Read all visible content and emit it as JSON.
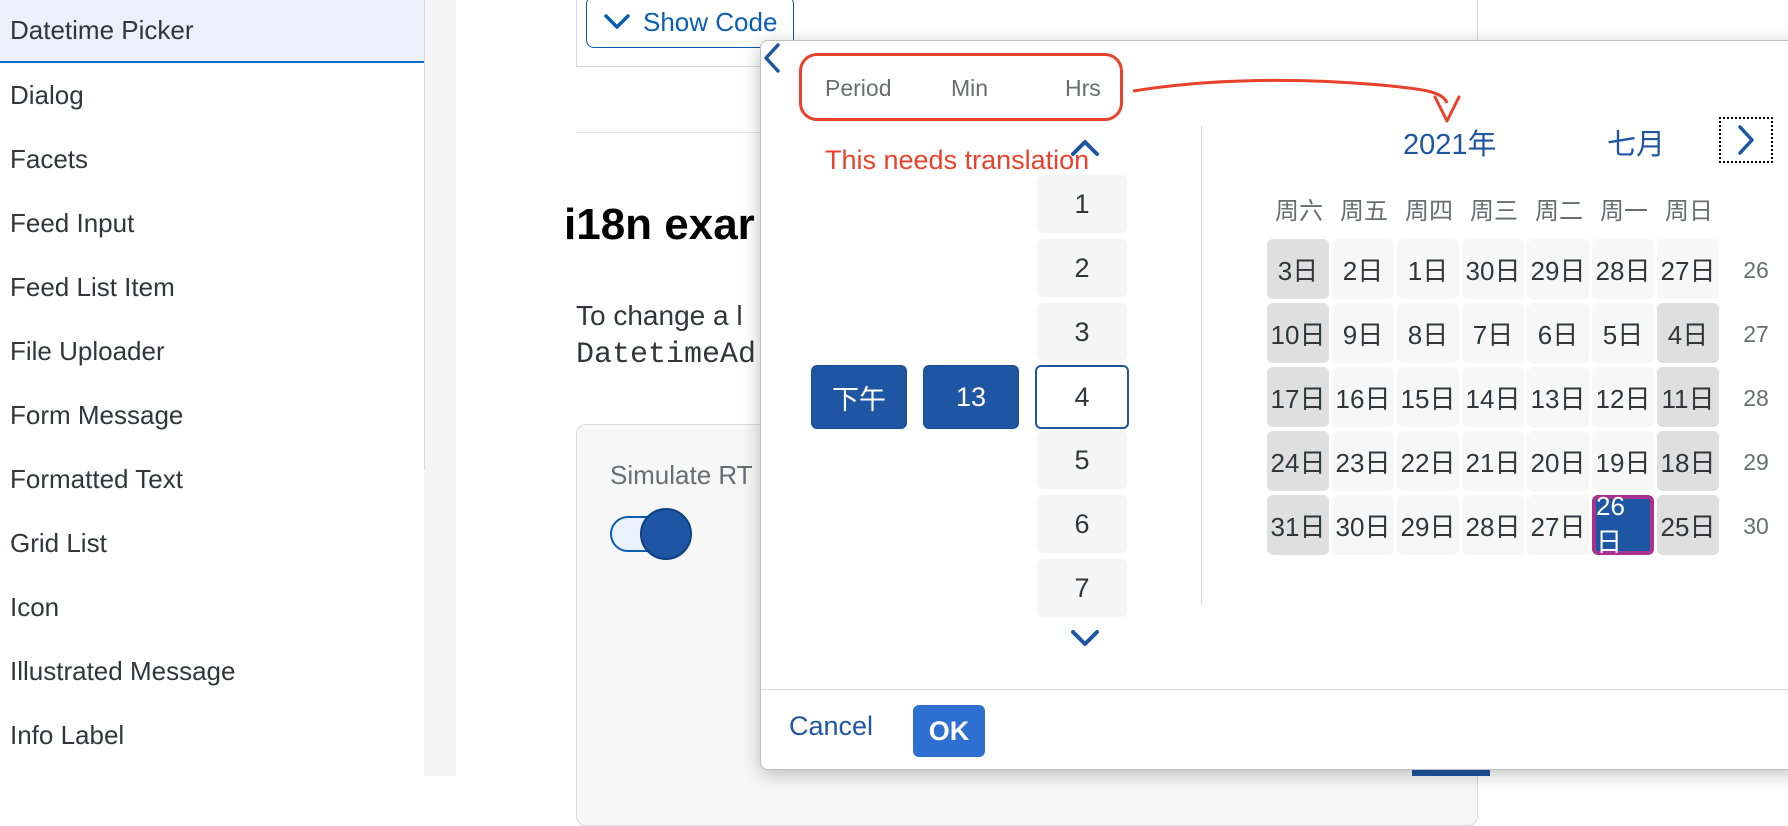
{
  "sidebar": {
    "items": [
      {
        "label": "Datetime Picker",
        "active": true
      },
      {
        "label": "Dialog"
      },
      {
        "label": "Facets"
      },
      {
        "label": "Feed Input"
      },
      {
        "label": "Feed List Item"
      },
      {
        "label": "File Uploader"
      },
      {
        "label": "Form Message"
      },
      {
        "label": "Formatted Text"
      },
      {
        "label": "Grid List"
      },
      {
        "label": "Icon"
      },
      {
        "label": "Illustrated Message"
      },
      {
        "label": "Info Label"
      }
    ]
  },
  "main": {
    "show_code_label": "Show Code",
    "section_title_visible": "i18n exar",
    "para_text_visible": "To change a l",
    "para_code_visible": "DatetimeAd",
    "rtl_label_visible": "Simulate RT",
    "rtl_toggle_on": true
  },
  "picker": {
    "time_headers": [
      "Period",
      "Min",
      "Hrs"
    ],
    "annotation": {
      "text": "This needs translation",
      "color": "#e8412c"
    },
    "period_value": "下午",
    "minute_value": "13",
    "hours": [
      "1",
      "2",
      "3",
      "4",
      "5",
      "6",
      "7"
    ],
    "focused_hour": "4",
    "calendar": {
      "year_label": "2021年",
      "month_label": "七月",
      "weekdays": [
        "周六",
        "周五",
        "周四",
        "周三",
        "周二",
        "周一",
        "周日"
      ],
      "weeks": [
        {
          "number": "26",
          "days": [
            "3日",
            "2日",
            "1日",
            "30日",
            "29日",
            "28日",
            "27日"
          ]
        },
        {
          "number": "27",
          "days": [
            "10日",
            "9日",
            "8日",
            "7日",
            "6日",
            "5日",
            "4日"
          ]
        },
        {
          "number": "28",
          "days": [
            "17日",
            "16日",
            "15日",
            "14日",
            "13日",
            "12日",
            "11日"
          ]
        },
        {
          "number": "29",
          "days": [
            "24日",
            "23日",
            "22日",
            "21日",
            "20日",
            "19日",
            "18日"
          ]
        },
        {
          "number": "30",
          "days": [
            "31日",
            "30日",
            "29日",
            "28日",
            "27日",
            "26日",
            "25日"
          ]
        }
      ],
      "selected_day": "26日"
    },
    "cancel_label": "Cancel",
    "ok_label": "OK"
  },
  "colors": {
    "accent": "#1f56a3",
    "annotation": "#e8412c",
    "today_border": "#a93291"
  }
}
